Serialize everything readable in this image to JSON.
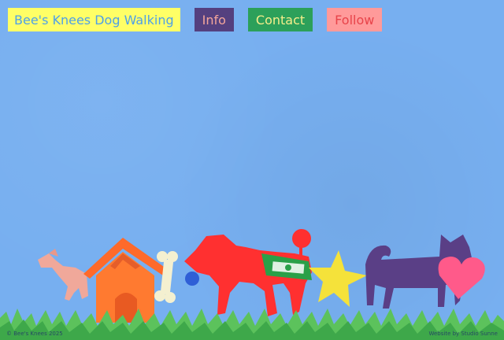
{
  "nav": {
    "brand": "Bee's Knees Dog Walking",
    "info": "Info",
    "contact": "Contact",
    "follow": "Follow"
  },
  "footer": {
    "copyright": "© Bee's Knees 2025",
    "credit": "Website by Studio Sunne"
  },
  "colors": {
    "background": "#77aff0",
    "brand_bg": "#ffff66",
    "info_bg": "#54407f",
    "contact_bg": "#2ca05a",
    "follow_bg": "#ff9a9a",
    "grass": "#5cc25c"
  },
  "illustration": {
    "items": [
      "dachshund",
      "dog-house",
      "bone",
      "poodle",
      "collar",
      "star",
      "cat-dog",
      "heart",
      "grass"
    ]
  }
}
